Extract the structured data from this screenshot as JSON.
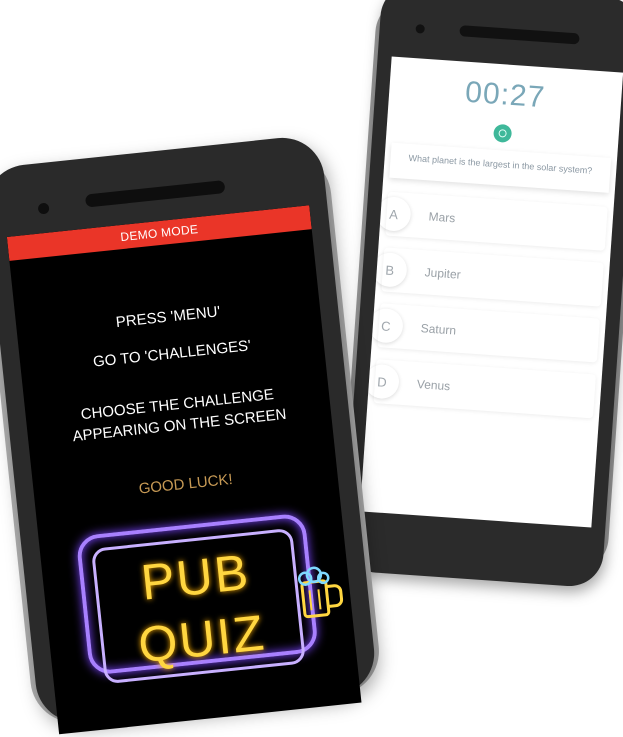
{
  "quiz_phone": {
    "timer": "00:27",
    "question": "What planet is the largest in the solar system?",
    "answers": [
      {
        "letter": "A",
        "text": "Mars"
      },
      {
        "letter": "B",
        "text": "Jupiter"
      },
      {
        "letter": "C",
        "text": "Saturn"
      },
      {
        "letter": "D",
        "text": "Venus"
      }
    ],
    "colors": {
      "timer": "#7aa7b8",
      "timer_dot": "#3fb89a"
    }
  },
  "pub_phone": {
    "banner": "DEMO MODE",
    "instructions": {
      "line1": "PRESS 'MENU'",
      "line2": "GO TO  'CHALLENGES'",
      "line3a": "CHOOSE THE CHALLENGE",
      "line3b": "APPEARING ON  THE SCREEN"
    },
    "good_luck": "GOOD LUCK!",
    "logo": {
      "line1": "PUB",
      "line2": "QUIZ"
    },
    "colors": {
      "banner": "#ea3528",
      "good_luck": "#c79a55",
      "neon_frame": "#a880ff",
      "neon_text": "#ffd640"
    }
  }
}
